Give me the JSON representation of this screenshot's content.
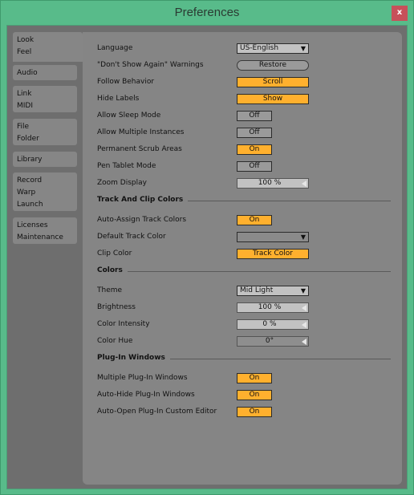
{
  "window": {
    "title": "Preferences",
    "close_label": "x"
  },
  "sidebar": {
    "groups": [
      {
        "tabs": [
          "Look",
          "Feel"
        ],
        "selected": true
      },
      {
        "tabs": [
          "Audio"
        ]
      },
      {
        "tabs": [
          "Link",
          "MIDI"
        ]
      },
      {
        "tabs": [
          "File",
          "Folder"
        ]
      },
      {
        "tabs": [
          "Library"
        ]
      },
      {
        "tabs": [
          "Record",
          "Warp",
          "Launch"
        ]
      },
      {
        "tabs": [
          "Licenses",
          "Maintenance"
        ]
      }
    ]
  },
  "general": {
    "language": {
      "label": "Language",
      "value": "US-English"
    },
    "warnings": {
      "label": "\"Don't Show Again\" Warnings",
      "value": "Restore"
    },
    "follow": {
      "label": "Follow Behavior",
      "value": "Scroll"
    },
    "hide_labels": {
      "label": "Hide Labels",
      "value": "Show"
    },
    "sleep": {
      "label": "Allow Sleep Mode",
      "value": "Off"
    },
    "multi_inst": {
      "label": "Allow Multiple Instances",
      "value": "Off"
    },
    "scrub": {
      "label": "Permanent Scrub Areas",
      "value": "On"
    },
    "pen": {
      "label": "Pen Tablet Mode",
      "value": "Off"
    },
    "zoom": {
      "label": "Zoom Display",
      "value": "100 %"
    }
  },
  "track_clip": {
    "title": "Track And Clip Colors",
    "auto_assign": {
      "label": "Auto-Assign Track Colors",
      "value": "On"
    },
    "default_color": {
      "label": "Default Track Color",
      "value": ""
    },
    "clip_color": {
      "label": "Clip Color",
      "value": "Track Color"
    }
  },
  "colors": {
    "title": "Colors",
    "theme": {
      "label": "Theme",
      "value": "Mid Light"
    },
    "brightness": {
      "label": "Brightness",
      "value": "100 %"
    },
    "intensity": {
      "label": "Color Intensity",
      "value": "0 %"
    },
    "hue": {
      "label": "Color Hue",
      "value": "0°"
    }
  },
  "plugins": {
    "title": "Plug-In Windows",
    "multiple": {
      "label": "Multiple Plug-In Windows",
      "value": "On"
    },
    "auto_hide": {
      "label": "Auto-Hide Plug-In Windows",
      "value": "On"
    },
    "auto_open": {
      "label": "Auto-Open Plug-In Custom Editor",
      "value": "On"
    }
  },
  "colors_hex": {
    "accent_on": "#ffb02e",
    "frame": "#58bb8a",
    "close": "#c7505a"
  },
  "icons": {
    "dropdown": "▼",
    "slider": "◀"
  }
}
